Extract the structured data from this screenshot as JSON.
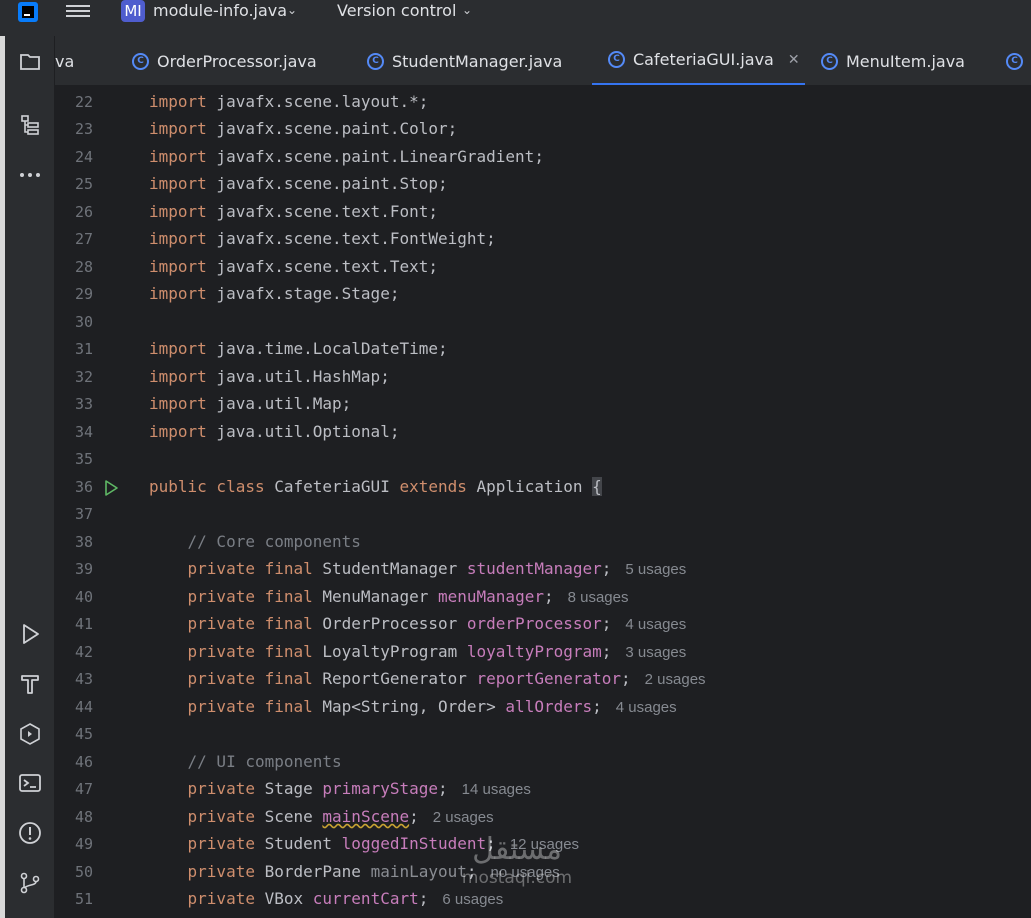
{
  "topbar": {
    "project_badge": "MI",
    "project_name": "module-info.java",
    "vcs_label": "Version control"
  },
  "tabs": [
    {
      "label": "va",
      "active": false
    },
    {
      "label": "OrderProcessor.java",
      "active": false
    },
    {
      "label": "StudentManager.java",
      "active": false
    },
    {
      "label": "CafeteriaGUI.java",
      "active": true
    },
    {
      "label": "MenuItem.java",
      "active": false
    }
  ],
  "left_toolbar": [
    "project-folder-icon",
    "structure-icon",
    "more-icon",
    "run-icon",
    "build-hammer-icon",
    "services-icon",
    "terminal-icon",
    "problems-icon",
    "git-icon"
  ],
  "editor": {
    "line_numbers": [
      "22",
      "23",
      "24",
      "25",
      "26",
      "27",
      "28",
      "29",
      "30",
      "31",
      "32",
      "33",
      "34",
      "35",
      "36",
      "37",
      "38",
      "39",
      "40",
      "41",
      "42",
      "43",
      "44",
      "45",
      "46",
      "47",
      "48",
      "49",
      "50",
      "51"
    ],
    "lines": {
      "l22": {
        "kw": "import",
        "rest": " javafx.scene.layout.*;"
      },
      "l23": {
        "kw": "import",
        "rest": " javafx.scene.paint.Color;"
      },
      "l24": {
        "kw": "import",
        "rest": " javafx.scene.paint.LinearGradient;"
      },
      "l25": {
        "kw": "import",
        "rest": " javafx.scene.paint.Stop;"
      },
      "l26": {
        "kw": "import",
        "rest": " javafx.scene.text.Font;"
      },
      "l27": {
        "kw": "import",
        "rest": " javafx.scene.text.FontWeight;"
      },
      "l28": {
        "kw": "import",
        "rest": " javafx.scene.text.Text;"
      },
      "l29": {
        "kw": "import",
        "rest": " javafx.stage.Stage;"
      },
      "l31": {
        "kw": "import",
        "rest": " java.time.LocalDateTime;"
      },
      "l32": {
        "kw": "import",
        "rest": " java.util.HashMap;"
      },
      "l33": {
        "kw": "import",
        "rest": " java.util.Map;"
      },
      "l34": {
        "kw": "import",
        "rest": " java.util.Optional;"
      },
      "l36": {
        "kw1": "public class",
        "name": " CafeteriaGUI ",
        "kw2": "extends",
        "base": " Application ",
        "brace": "{"
      },
      "l38": {
        "comment": "// Core components"
      },
      "l39": {
        "kw": "private final",
        "type": " StudentManager ",
        "field": "studentManager",
        "end": ";",
        "usage": "5 usages"
      },
      "l40": {
        "kw": "private final",
        "type": " MenuManager ",
        "field": "menuManager",
        "end": ";",
        "usage": "8 usages"
      },
      "l41": {
        "kw": "private final",
        "type": " OrderProcessor ",
        "field": "orderProcessor",
        "end": ";",
        "usage": "4 usages"
      },
      "l42": {
        "kw": "private final",
        "type": " LoyaltyProgram ",
        "field": "loyaltyProgram",
        "end": ";",
        "usage": "3 usages"
      },
      "l43": {
        "kw": "private final",
        "type": " ReportGenerator ",
        "field": "reportGenerator",
        "end": ";",
        "usage": "2 usages"
      },
      "l44": {
        "kw": "private final",
        "type": " Map<String, Order> ",
        "field": "allOrders",
        "end": ";",
        "usage": "4 usages"
      },
      "l46": {
        "comment": "// UI components"
      },
      "l47": {
        "kw": "private",
        "type": " Stage ",
        "field": "primaryStage",
        "end": ";",
        "usage": "14 usages"
      },
      "l48": {
        "kw": "private",
        "type": " Scene ",
        "field": "mainScene",
        "end": ";",
        "usage": "2 usages"
      },
      "l49": {
        "kw": "private",
        "type": " Student ",
        "field": "loggedInStudent",
        "end": ";",
        "usage": "12 usages"
      },
      "l50": {
        "kw": "private",
        "type": " BorderPane ",
        "field": "mainLayout",
        "end": ";",
        "usage": "no usages"
      },
      "l51": {
        "kw": "private",
        "type": " VBox ",
        "field": "currentCart",
        "end": ";",
        "usage": "6 usages"
      }
    }
  },
  "watermark": {
    "arabic": "مستقل",
    "latin": "mostaql.com"
  },
  "colors": {
    "background": "#1e1f22",
    "panel": "#2b2d30",
    "keyword": "#cf8e6d",
    "field": "#c77dbb",
    "comment": "#7a7e85",
    "accent": "#3574f0"
  }
}
